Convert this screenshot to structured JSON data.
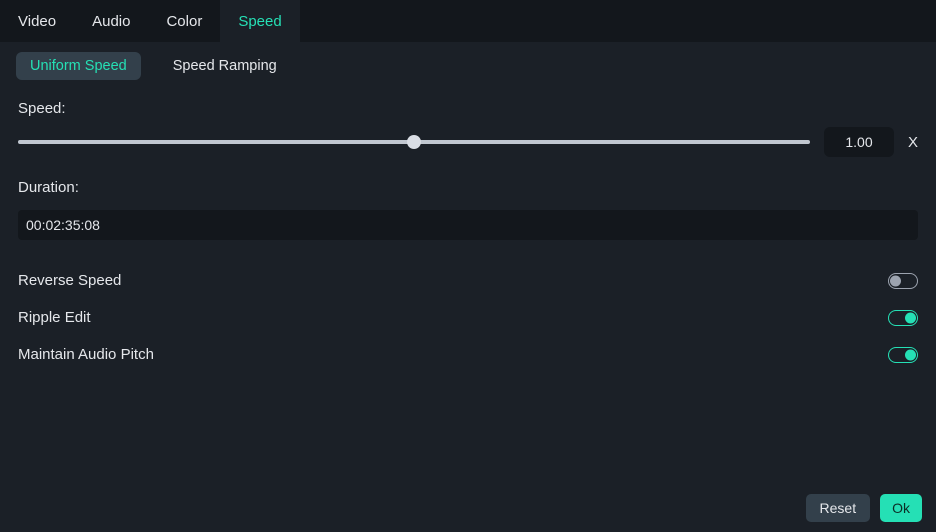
{
  "top_tabs": {
    "video": "Video",
    "audio": "Audio",
    "color": "Color",
    "speed": "Speed",
    "active": "speed"
  },
  "sub_tabs": {
    "uniform": "Uniform Speed",
    "ramping": "Speed Ramping",
    "active": "uniform"
  },
  "speed": {
    "label": "Speed:",
    "value": "1.00",
    "suffix": "X",
    "slider_percent": 50
  },
  "duration": {
    "label": "Duration:",
    "value": "00:02:35:08"
  },
  "toggles": {
    "reverse_speed": {
      "label": "Reverse Speed",
      "on": false
    },
    "ripple_edit": {
      "label": "Ripple Edit",
      "on": true
    },
    "maintain_pitch": {
      "label": "Maintain Audio Pitch",
      "on": true
    }
  },
  "footer": {
    "reset": "Reset",
    "ok": "Ok"
  },
  "colors": {
    "accent": "#25e0b5",
    "bg": "#1b2027",
    "bg_dark": "#13171c",
    "chip": "#33404b"
  }
}
